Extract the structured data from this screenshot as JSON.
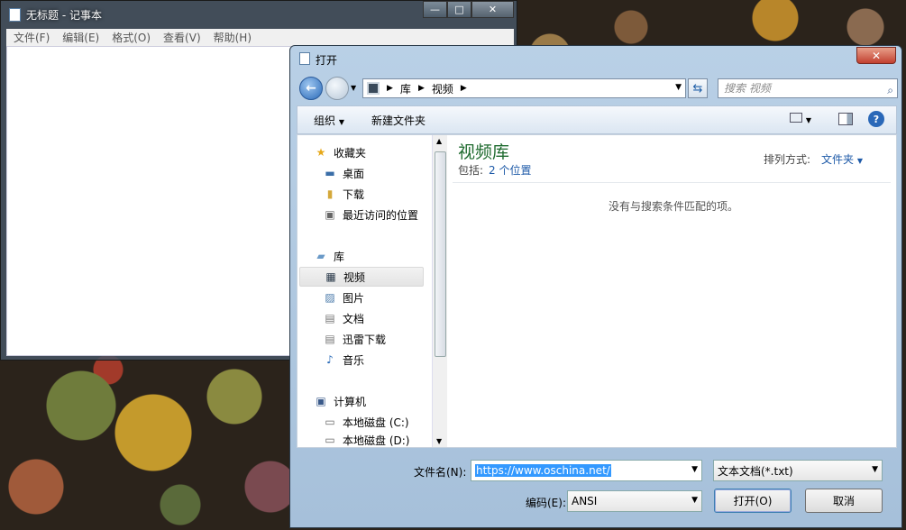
{
  "notepad": {
    "title": "无标题 - 记事本",
    "menu": [
      "文件(F)",
      "编辑(E)",
      "格式(O)",
      "查看(V)",
      "帮助(H)"
    ]
  },
  "dialog": {
    "title": "打开",
    "address": {
      "crumbs": [
        "库",
        "视频"
      ]
    },
    "search_placeholder": "搜索 视频",
    "toolbar": {
      "organize": "组织",
      "new_folder": "新建文件夹"
    },
    "nav": {
      "favorites": "收藏夹",
      "desktop": "桌面",
      "downloads": "下载",
      "recent": "最近访问的位置",
      "libraries": "库",
      "videos": "视频",
      "pictures": "图片",
      "documents": "文档",
      "thunder": "迅雷下载",
      "music": "音乐",
      "computer": "计算机",
      "disk_c": "本地磁盘 (C:)",
      "disk_d": "本地磁盘 (D:)"
    },
    "library": {
      "title": "视频库",
      "includes_label": "包括:",
      "includes_link": "2 个位置",
      "arrange_label": "排列方式:",
      "arrange_value": "文件夹",
      "empty_message": "没有与搜索条件匹配的项。"
    },
    "bottom": {
      "filename_label": "文件名(N):",
      "filename_value": "https://www.oschina.net/",
      "filetype_value": "文本文档(*.txt)",
      "encoding_label": "编码(E):",
      "encoding_value": "ANSI",
      "open_button": "打开(O)",
      "cancel_button": "取消"
    }
  }
}
